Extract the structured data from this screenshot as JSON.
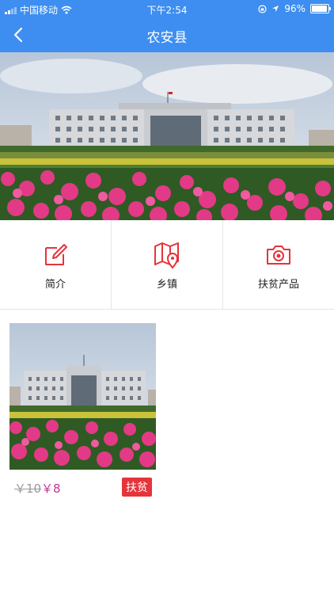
{
  "status": {
    "carrier": "中国移动",
    "time": "下午2:54",
    "battery": "96%",
    "battery_level": 0.96
  },
  "nav": {
    "title": "农安县",
    "back_icon": "chevron-left-icon"
  },
  "menu": {
    "items": [
      {
        "label": "简介",
        "icon": "edit-icon"
      },
      {
        "label": "乡镇",
        "icon": "map-pin-icon"
      },
      {
        "label": "扶贫产品",
        "icon": "camera-icon"
      }
    ]
  },
  "product": {
    "old_price": "￥10",
    "price": "￥8",
    "tag": "扶贫"
  },
  "colors": {
    "primary": "#3d8ef0",
    "accent_red": "#e5343a",
    "price_color": "#c0359a"
  }
}
